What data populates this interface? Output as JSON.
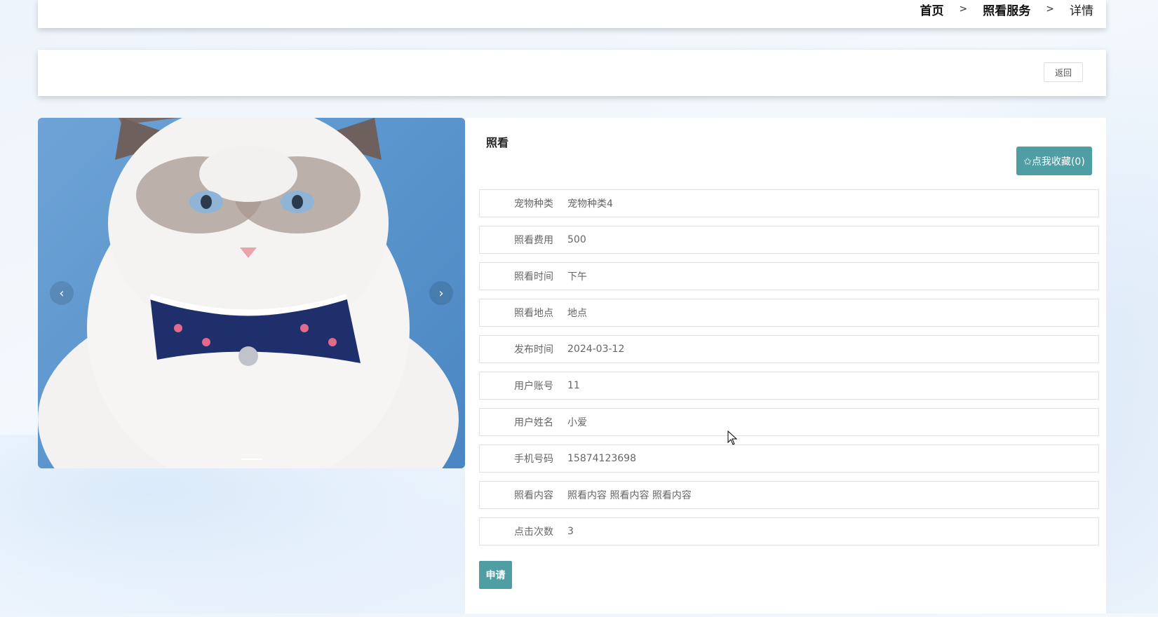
{
  "breadcrumb": {
    "home": "首页",
    "section": "照看服务",
    "current": "详情",
    "separator": ">"
  },
  "actions": {
    "back_label": "返回"
  },
  "carousel": {
    "prev": "‹",
    "next": "›",
    "image_subject": "white ragdoll cat with navy polka-dot bow tie and bell",
    "slide_count_visible": 1
  },
  "detail": {
    "title": "照看",
    "favorite_label": "✩点我收藏(0)",
    "fields": [
      {
        "label": "宠物种类",
        "value": "宠物种类4"
      },
      {
        "label": "照看费用",
        "value": "500"
      },
      {
        "label": "照看时间",
        "value": "下午"
      },
      {
        "label": "照看地点",
        "value": "地点"
      },
      {
        "label": "发布时间",
        "value": "2024-03-12"
      },
      {
        "label": "用户账号",
        "value": "11"
      },
      {
        "label": "用户姓名",
        "value": "小爱"
      },
      {
        "label": "手机号码",
        "value": "15874123698"
      },
      {
        "label": "照看内容",
        "value": "照看内容 照看内容 照看内容"
      },
      {
        "label": "点击次数",
        "value": "3"
      }
    ],
    "apply_label": "申请"
  },
  "colors": {
    "accent": "#4e9ea3",
    "background": "#eef4fb"
  }
}
